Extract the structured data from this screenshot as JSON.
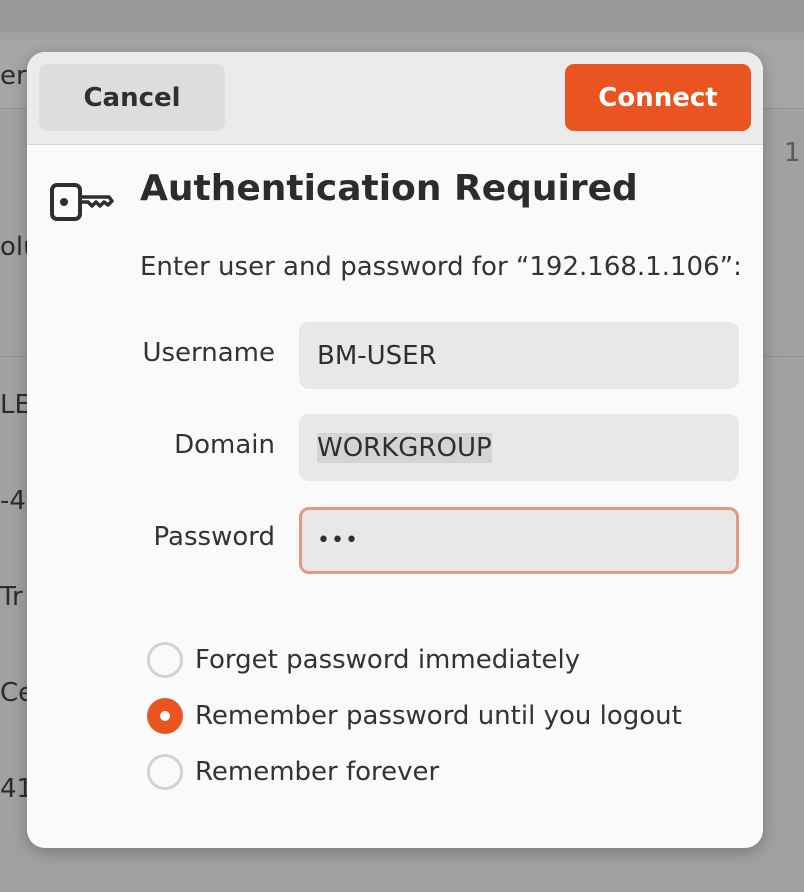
{
  "background": {
    "fragments": [
      "er",
      "olu",
      "LE",
      "-4",
      "Tr",
      "Ce",
      "41",
      "1"
    ]
  },
  "dialog": {
    "cancel_label": "Cancel",
    "connect_label": "Connect",
    "icon": "key-icon",
    "title": "Authentication Required",
    "subtitle": "Enter user and password for “192.168.1.106”:",
    "fields": {
      "username": {
        "label": "Username",
        "value": "BM-USER"
      },
      "domain": {
        "label": "Domain",
        "value": "WORKGROUP"
      },
      "password": {
        "label": "Password",
        "value": "•••"
      }
    },
    "options": [
      {
        "label": "Forget password immediately",
        "selected": false
      },
      {
        "label": "Remember password until you logout",
        "selected": true
      },
      {
        "label": "Remember forever",
        "selected": false
      }
    ]
  },
  "colors": {
    "accent": "#e95420",
    "focus_border": "#e09b80"
  }
}
